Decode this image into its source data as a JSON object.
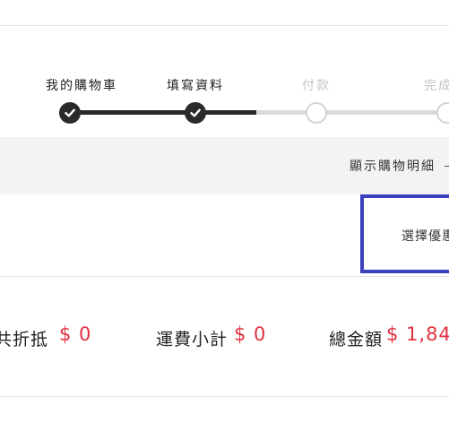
{
  "stepper": {
    "steps": [
      {
        "label": "我的購物車",
        "state": "done"
      },
      {
        "label": "填寫資料",
        "state": "done"
      },
      {
        "label": "付款",
        "state": "pending"
      },
      {
        "label": "完成",
        "state": "pending"
      }
    ],
    "done_color": "#2a2a2a",
    "pending_color": "#d9d9d9"
  },
  "details": {
    "toggle_label": "顯示購物明細",
    "bar_color": "#f3f3f3"
  },
  "coupon": {
    "label": "選擇優惠",
    "border_color": "#3b40bd"
  },
  "totals": {
    "discount_label": "共折抵",
    "discount_value": "$ 0",
    "shipping_label": "運費小計",
    "shipping_value": "$ 0",
    "grand_label": "總金額",
    "grand_value": "$ 1,84",
    "value_color": "#e0313f"
  },
  "icons": {
    "step_done": "check-icon",
    "details_toggle": "chevron-down-icon"
  }
}
